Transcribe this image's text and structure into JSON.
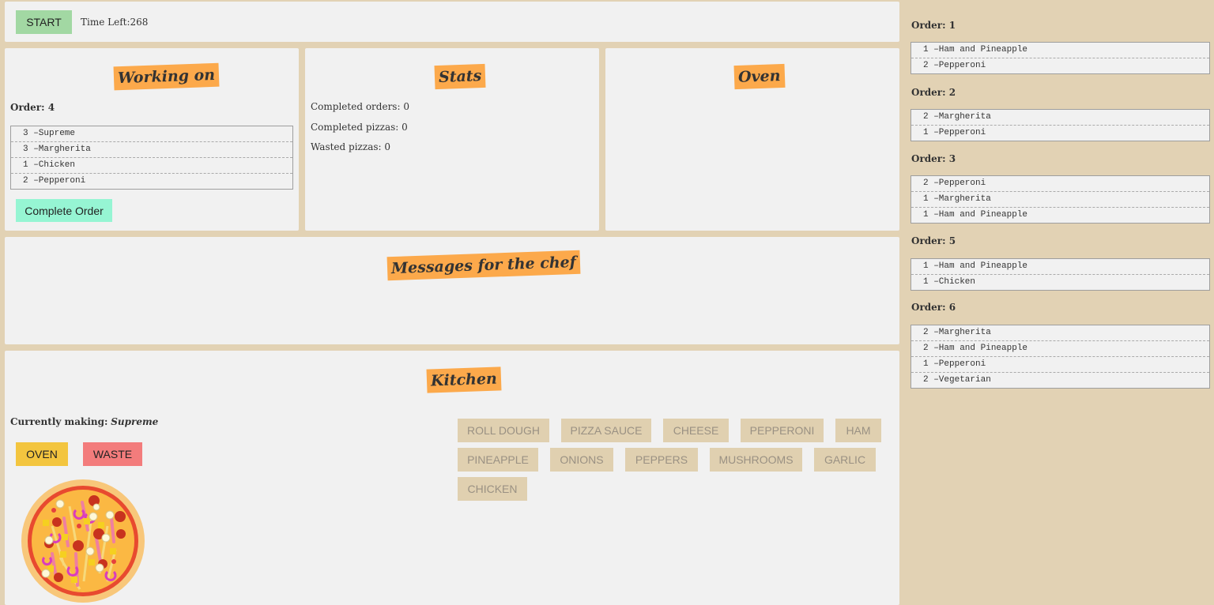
{
  "header": {
    "start_label": "START",
    "time_left": "Time Left:268"
  },
  "working_on": {
    "title": "Working on",
    "order_label": "Order: 4",
    "items": [
      "3 –Supreme",
      "3 –Margherita",
      "1 –Chicken",
      "2 –Pepperoni"
    ],
    "complete_label": "Complete Order"
  },
  "stats": {
    "title": "Stats",
    "completed_orders": "Completed orders: 0",
    "completed_pizzas": "Completed pizzas: 0",
    "wasted_pizzas": "Wasted pizzas: 0"
  },
  "oven": {
    "title": "Oven"
  },
  "messages": {
    "title": "Messages for the chef"
  },
  "kitchen": {
    "title": "Kitchen",
    "currently_making_label": "Currently making:",
    "currently_making_value": "Supreme",
    "oven_label": "OVEN",
    "waste_label": "WASTE",
    "ingredients": [
      "ROLL DOUGH",
      "PIZZA SAUCE",
      "CHEESE",
      "PEPPERONI",
      "HAM",
      "PINEAPPLE",
      "ONIONS",
      "PEPPERS",
      "MUSHROOMS",
      "GARLIC",
      "CHICKEN"
    ]
  },
  "orders": [
    {
      "label": "Order: 1",
      "items": [
        "1 –Ham and Pineapple",
        "2 –Pepperoni"
      ]
    },
    {
      "label": "Order: 2",
      "items": [
        "2 –Margherita",
        "1 –Pepperoni"
      ]
    },
    {
      "label": "Order: 3",
      "items": [
        "2 –Pepperoni",
        "1 –Margherita",
        "1 –Ham and Pineapple"
      ]
    },
    {
      "label": "Order: 5",
      "items": [
        "1 –Ham and Pineapple",
        "1 –Chicken"
      ]
    },
    {
      "label": "Order: 6",
      "items": [
        "2 –Margherita",
        "2 –Ham and Pineapple",
        "1 –Pepperoni",
        "2 –Vegetarian"
      ]
    }
  ],
  "colors": {
    "background": "#e2d2b4",
    "panel": "#f1f1f1",
    "tag": "#fca94b",
    "start": "#a2d8a3",
    "complete": "#96f5d3",
    "oven": "#f3c53f",
    "waste": "#f37c7c",
    "ingredient": "#e0d0b0"
  }
}
